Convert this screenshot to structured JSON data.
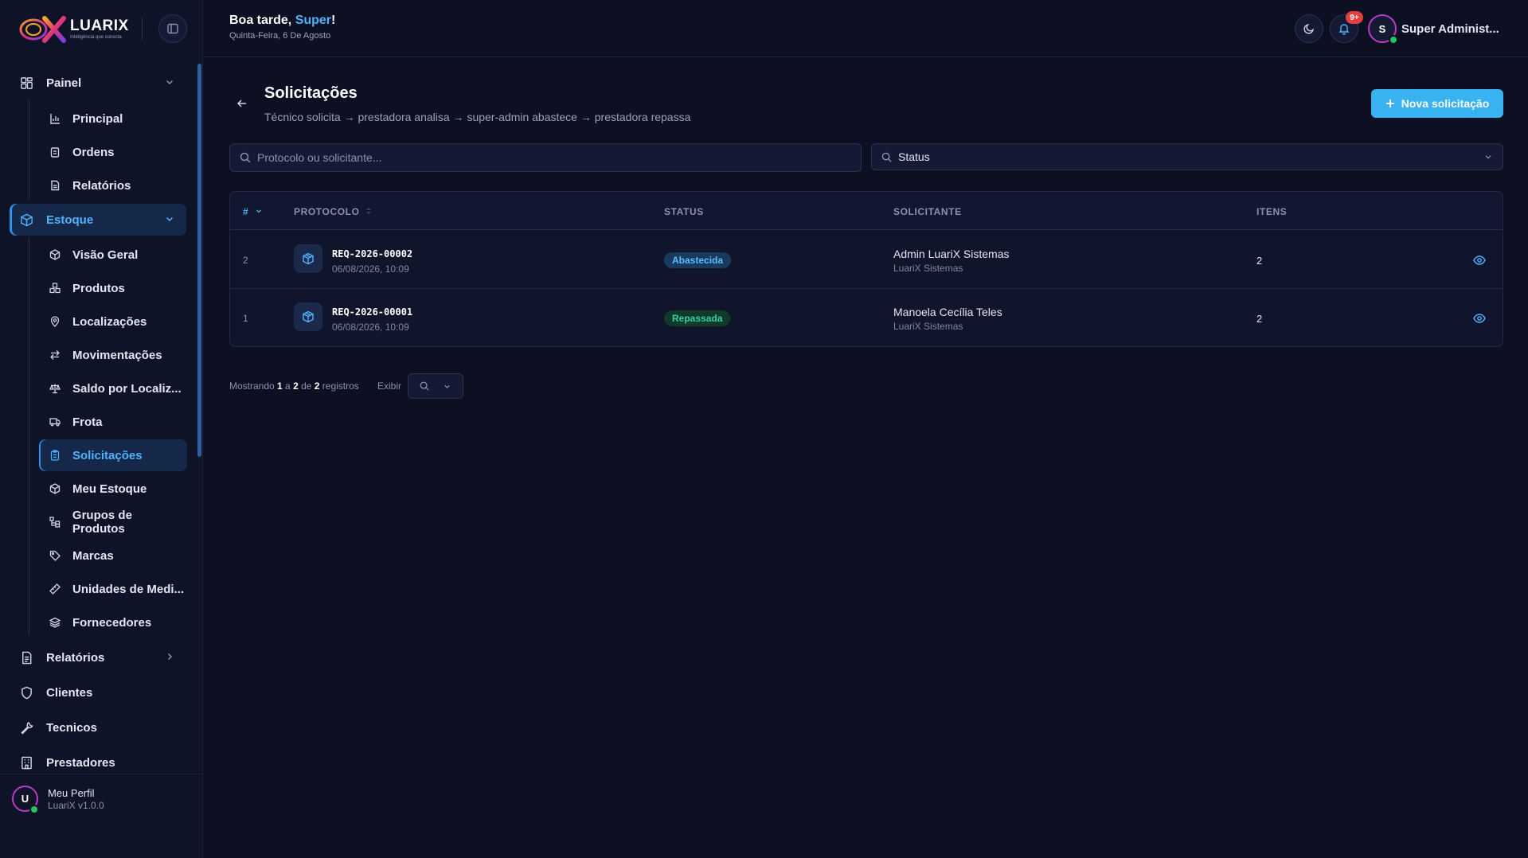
{
  "brand": {
    "name": "LUARIX",
    "tagline": "Inteligência que conecta"
  },
  "header": {
    "greeting_prefix": "Boa tarde, ",
    "greeting_name": "Super",
    "greeting_suffix": "!",
    "date": "Quinta-Feira, 6 De Agosto",
    "notification_count": "9+",
    "user_initial": "S",
    "user_name": "Super Administ..."
  },
  "sidebar": {
    "groups": [
      {
        "label": "Painel",
        "icon": "dashboard-icon"
      },
      {
        "label": "Estoque",
        "icon": "box-icon"
      },
      {
        "label": "Relatórios",
        "icon": "document-icon"
      },
      {
        "label": "Clientes",
        "icon": "shield-icon"
      },
      {
        "label": "Tecnicos",
        "icon": "wrench-icon"
      },
      {
        "label": "Prestadores",
        "icon": "building-icon"
      }
    ],
    "painel_items": [
      "Principal",
      "Ordens",
      "Relatórios"
    ],
    "estoque_items": [
      "Visão Geral",
      "Produtos",
      "Localizações",
      "Movimentações",
      "Saldo por Localiz...",
      "Frota",
      "Solicitações",
      "Meu Estoque",
      "Grupos de Produtos",
      "Marcas",
      "Unidades de Medi...",
      "Fornecedores"
    ],
    "footer": {
      "initial": "U",
      "name": "Meu Perfil",
      "version": "LuariX v1.0.0"
    }
  },
  "page": {
    "title": "Solicitações",
    "subtitle": "Técnico solicita → prestadora analisa → super-admin abastece → prestadora repassa",
    "new_button": "Nova solicitação",
    "search_placeholder": "Protocolo ou solicitante...",
    "status_filter": "Status"
  },
  "table": {
    "columns": [
      "#",
      "PROTOCOLO",
      "STATUS",
      "SOLICITANTE",
      "ITENS"
    ],
    "rows": [
      {
        "id": "2",
        "protocol": "REQ-2026-00002",
        "date": "06/08/2026, 10:09",
        "status": "Abastecida",
        "status_color": "#5cc0ff",
        "requester": "Admin LuariX Sistemas",
        "org": "LuariX Sistemas",
        "items": "2"
      },
      {
        "id": "1",
        "protocol": "REQ-2026-00001",
        "date": "06/08/2026, 10:09",
        "status": "Repassada",
        "status_color": "#34d399",
        "requester": "Manoela Cecília Teles",
        "org": "LuariX Sistemas",
        "items": "2"
      }
    ]
  },
  "pagination": {
    "prefix": "Mostrando ",
    "from": "1",
    "sep1": " a ",
    "to": "2",
    "sep2": " de ",
    "total": "2",
    "suffix": " registros",
    "show_label": "Exibir"
  },
  "colors": {
    "accent": "#38b2f0",
    "active": "#4fb3ff",
    "background": "#0c1022",
    "sidebar": "#0e1328"
  }
}
